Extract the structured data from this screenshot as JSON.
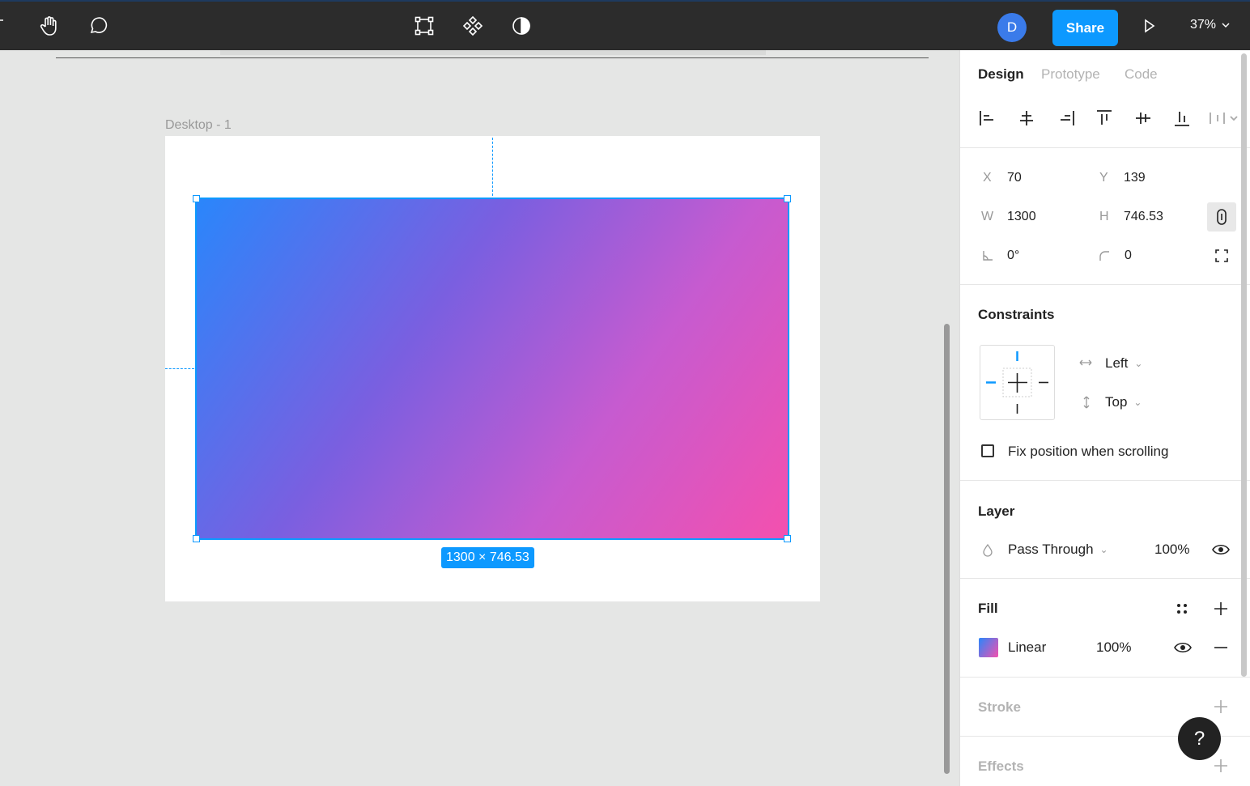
{
  "toolbar": {
    "avatar_initial": "D",
    "share_label": "Share",
    "zoom_label": "37%",
    "icons": [
      "text-tool-icon",
      "hand-tool-icon",
      "comment-tool-icon",
      "frame-transform-icon",
      "component-icon",
      "contrast-mask-icon",
      "play-icon",
      "chevron-down-icon"
    ]
  },
  "canvas": {
    "frame_label": "Desktop - 1",
    "selection_size": "1300 × 746.53",
    "gradient_colors": [
      "#2a86fb",
      "#7a5fe0",
      "#c65bd0",
      "#f450ae"
    ],
    "selection_color": "#0d99ff"
  },
  "panel": {
    "tabs": [
      {
        "label": "Design",
        "active": true
      },
      {
        "label": "Prototype",
        "active": false
      },
      {
        "label": "Code",
        "active": false
      }
    ],
    "position": {
      "x_label": "X",
      "x_value": "70",
      "y_label": "Y",
      "y_value": "139",
      "w_label": "W",
      "w_value": "1300",
      "h_label": "H",
      "h_value": "746.53",
      "rotation_value": "0°",
      "radius_value": "0"
    },
    "constraints": {
      "title": "Constraints",
      "horizontal": "Left",
      "vertical": "Top",
      "fix_position_label": "Fix position when scrolling",
      "fix_position_checked": false
    },
    "layer": {
      "title": "Layer",
      "blend_mode": "Pass Through",
      "opacity": "100%"
    },
    "fill": {
      "title": "Fill",
      "type": "Linear",
      "opacity": "100%"
    },
    "stroke": {
      "title": "Stroke"
    },
    "effects": {
      "title": "Effects"
    },
    "help_label": "?"
  }
}
